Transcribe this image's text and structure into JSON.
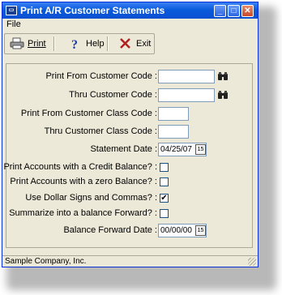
{
  "window": {
    "title": "Print A/R Customer Statements"
  },
  "menu": {
    "file": "File"
  },
  "toolbar": {
    "print": "Print",
    "help": "Help",
    "exit": "Exit"
  },
  "form": {
    "print_from_customer_code": "Print From Customer Code :",
    "thru_customer_code": "Thru Customer Code :",
    "print_from_customer_class_code": "Print From Customer Class Code :",
    "thru_customer_class_code": "Thru  Customer Class Code :",
    "statement_date_label": "Statement Date :",
    "statement_date_value": "04/25/07",
    "credit_balance_label": "Print Accounts with a Credit Balance? :",
    "zero_balance_label": "Print Accounts with a zero Balance? :",
    "dollar_signs_label": "Use Dollar Signs and Commas? :",
    "summarize_label": "Summarize into a balance Forward? :",
    "balance_forward_date_label": "Balance Forward Date :",
    "balance_forward_date_value": "00/00/00",
    "credit_balance_checked": false,
    "zero_balance_checked": false,
    "dollar_signs_checked": true,
    "summarize_checked": false
  },
  "status": {
    "company": "Sample Company, Inc."
  },
  "colors": {
    "titlebar": "#0a5bdc",
    "window_bg": "#ece9d8",
    "field_border": "#7f9db9"
  }
}
